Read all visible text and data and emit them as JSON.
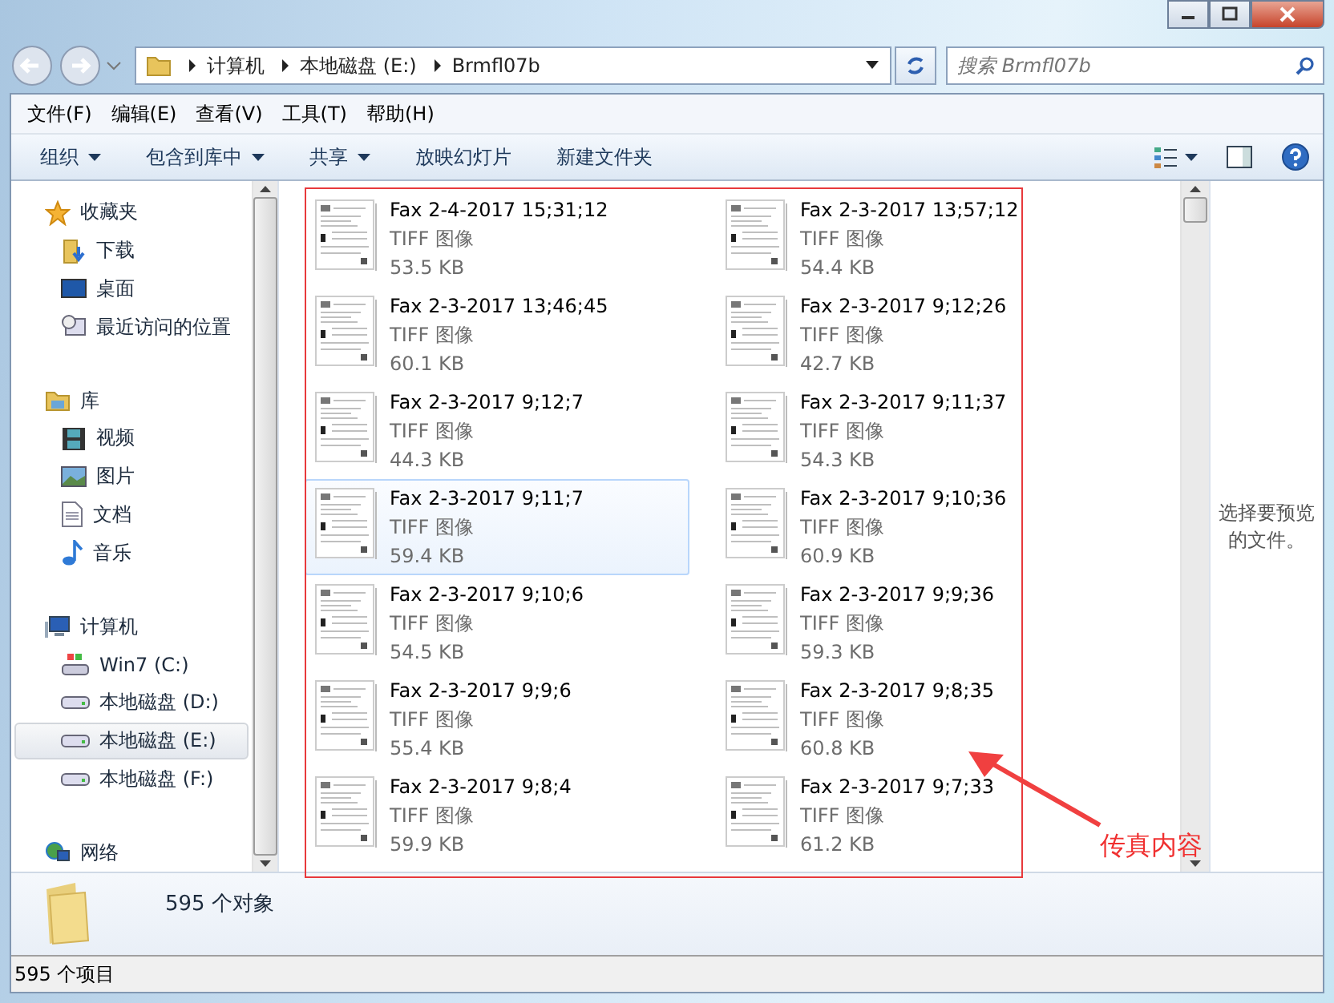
{
  "address": {
    "breadcrumbs": [
      "计算机",
      "本地磁盘 (E:)",
      "Brmfl07b"
    ]
  },
  "search": {
    "placeholder": "搜索 Brmfl07b"
  },
  "menu": [
    "文件(F)",
    "编辑(E)",
    "查看(V)",
    "工具(T)",
    "帮助(H)"
  ],
  "toolbar": [
    {
      "label": "组织",
      "dropdown": true
    },
    {
      "label": "包含到库中",
      "dropdown": true
    },
    {
      "label": "共享",
      "dropdown": true
    },
    {
      "label": "放映幻灯片",
      "dropdown": false
    },
    {
      "label": "新建文件夹",
      "dropdown": false
    }
  ],
  "sidebar": {
    "groups": [
      {
        "label": "收藏夹",
        "kind": "favorites",
        "children": [
          {
            "label": "下载",
            "kind": "downloads",
            "selected": false
          },
          {
            "label": "桌面",
            "kind": "desktop",
            "selected": false
          },
          {
            "label": "最近访问的位置",
            "kind": "recent",
            "selected": false
          }
        ]
      },
      {
        "label": "库",
        "kind": "library",
        "children": [
          {
            "label": "视频",
            "kind": "video",
            "selected": false
          },
          {
            "label": "图片",
            "kind": "pictures",
            "selected": false
          },
          {
            "label": "文档",
            "kind": "documents",
            "selected": false
          },
          {
            "label": "音乐",
            "kind": "music",
            "selected": false
          }
        ]
      },
      {
        "label": "计算机",
        "kind": "computer",
        "children": [
          {
            "label": "Win7 (C:)",
            "kind": "system-drive",
            "selected": false
          },
          {
            "label": "本地磁盘 (D:)",
            "kind": "drive",
            "selected": false
          },
          {
            "label": "本地磁盘 (E:)",
            "kind": "drive",
            "selected": true
          },
          {
            "label": "本地磁盘 (F:)",
            "kind": "drive",
            "selected": false
          }
        ]
      },
      {
        "label": "网络",
        "kind": "network"
      }
    ]
  },
  "files": [
    {
      "name": "Fax 2-4-2017 15;31;12",
      "type": "TIFF 图像",
      "size": "53.5 KB",
      "selected": false
    },
    {
      "name": "Fax 2-3-2017 13;57;12",
      "type": "TIFF 图像",
      "size": "54.4 KB",
      "selected": false
    },
    {
      "name": "Fax 2-3-2017 13;46;45",
      "type": "TIFF 图像",
      "size": "60.1 KB",
      "selected": false
    },
    {
      "name": "Fax 2-3-2017 9;12;26",
      "type": "TIFF 图像",
      "size": "42.7 KB",
      "selected": false
    },
    {
      "name": "Fax 2-3-2017 9;12;7",
      "type": "TIFF 图像",
      "size": "44.3 KB",
      "selected": false
    },
    {
      "name": "Fax 2-3-2017 9;11;37",
      "type": "TIFF 图像",
      "size": "54.3 KB",
      "selected": false
    },
    {
      "name": "Fax 2-3-2017 9;11;7",
      "type": "TIFF 图像",
      "size": "59.4 KB",
      "selected": true
    },
    {
      "name": "Fax 2-3-2017 9;10;36",
      "type": "TIFF 图像",
      "size": "60.9 KB",
      "selected": false
    },
    {
      "name": "Fax 2-3-2017 9;10;6",
      "type": "TIFF 图像",
      "size": "54.5 KB",
      "selected": false
    },
    {
      "name": "Fax 2-3-2017 9;9;36",
      "type": "TIFF 图像",
      "size": "59.3 KB",
      "selected": false
    },
    {
      "name": "Fax 2-3-2017 9;9;6",
      "type": "TIFF 图像",
      "size": "55.4 KB",
      "selected": false
    },
    {
      "name": "Fax 2-3-2017 9;8;35",
      "type": "TIFF 图像",
      "size": "60.8 KB",
      "selected": false
    },
    {
      "name": "Fax 2-3-2017 9;8;4",
      "type": "TIFF 图像",
      "size": "59.9 KB",
      "selected": false
    },
    {
      "name": "Fax 2-3-2017 9;7;33",
      "type": "TIFF 图像",
      "size": "61.2 KB",
      "selected": false
    }
  ],
  "preview": {
    "message": "选择要预览的文件。"
  },
  "details": {
    "count": "595 个对象"
  },
  "status_bar": {
    "text": "595 个项目"
  },
  "annotation": {
    "label": "传真内容"
  }
}
